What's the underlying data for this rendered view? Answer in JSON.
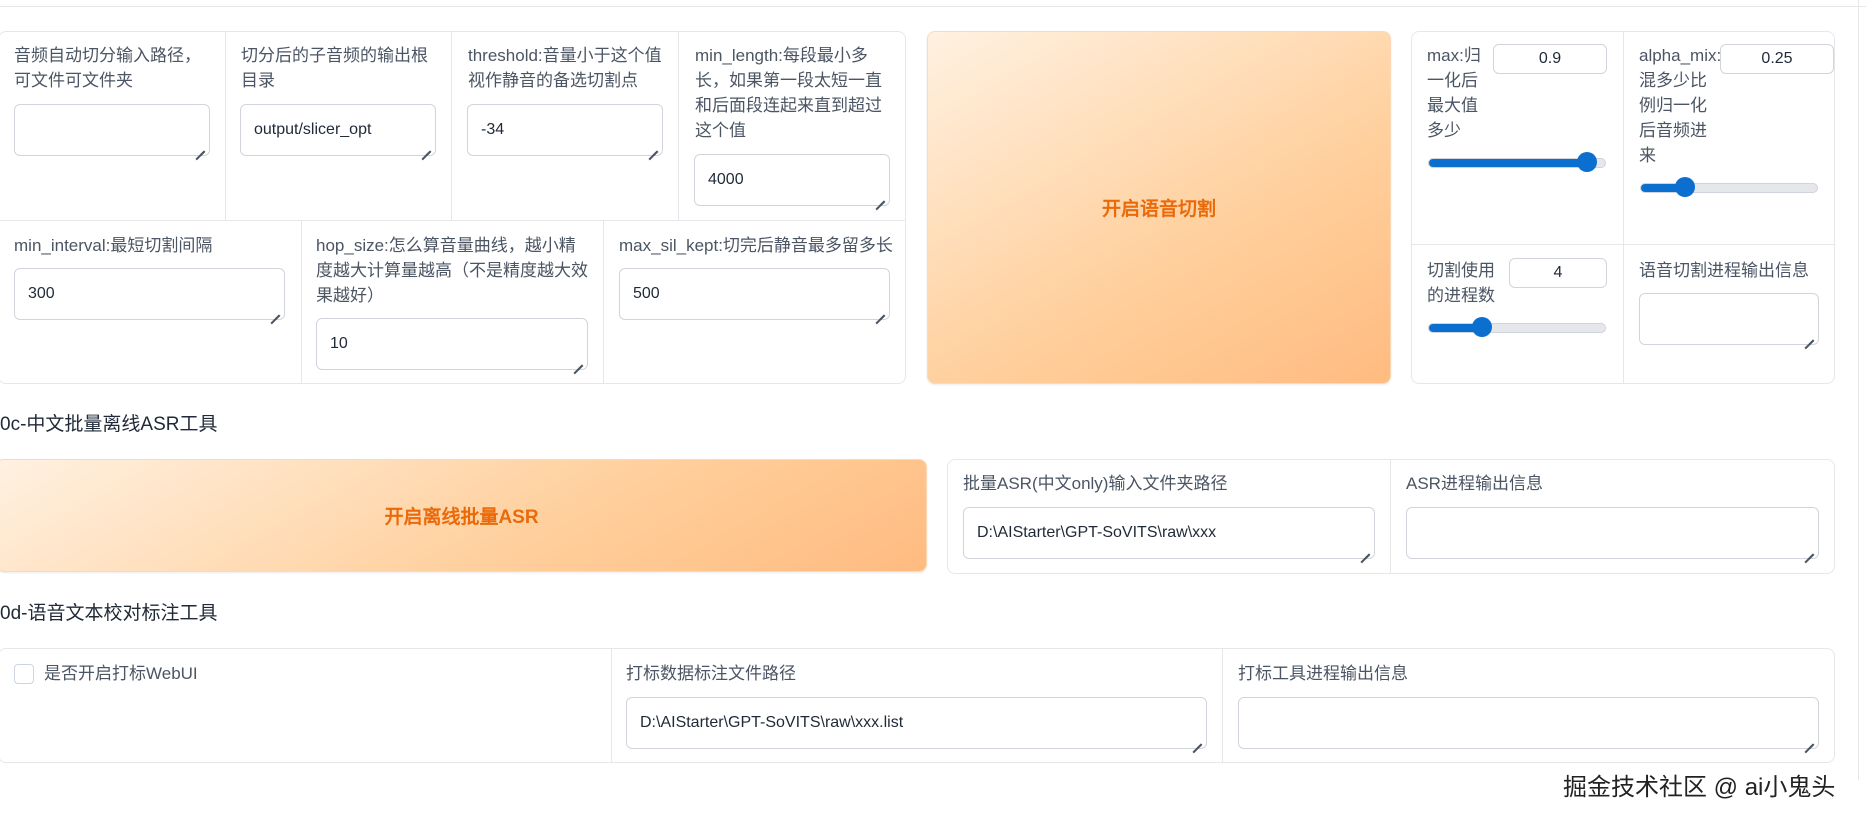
{
  "slicer": {
    "input_path": {
      "label": "音频自动切分输入路径，可文件可文件夹",
      "value": ""
    },
    "output_dir": {
      "label": "切分后的子音频的输出根目录",
      "value": "output/slicer_opt"
    },
    "threshold": {
      "label": "threshold:音量小于这个值视作静音的备选切割点",
      "value": "-34"
    },
    "min_length": {
      "label": "min_length:每段最小多长，如果第一段太短一直和后面段连起来直到超过这个值",
      "value": "4000"
    },
    "min_interval": {
      "label": "min_interval:最短切割间隔",
      "value": "300"
    },
    "hop_size": {
      "label": "hop_size:怎么算音量曲线，越小精度越大计算量越高（不是精度越大效果越好）",
      "value": "10"
    },
    "max_sil_kept": {
      "label": "max_sil_kept:切完后静音最多留多长",
      "value": "500"
    },
    "start_button": "开启语音切割",
    "max": {
      "label": "max:归一化后最大值多少",
      "value": "0.9",
      "level": 0.9
    },
    "alpha_mix": {
      "label": "alpha_mix:混多少比例归一化后音频进来",
      "value": "0.25",
      "level": 0.25
    },
    "n_process": {
      "label": "切割使用的进程数",
      "value": "4",
      "level": 0.3
    },
    "output_info": {
      "label": "语音切割进程输出信息",
      "value": ""
    }
  },
  "asr": {
    "section_title": "0c-中文批量离线ASR工具",
    "start_button": "开启离线批量ASR",
    "input_dir": {
      "label": "批量ASR(中文only)输入文件夹路径",
      "value": "D:\\AIStarter\\GPT-SoVITS\\raw\\xxx"
    },
    "output_info": {
      "label": "ASR进程输出信息",
      "value": ""
    }
  },
  "label": {
    "section_title": "0d-语音文本校对标注工具",
    "webui_checkbox": {
      "label": "是否开启打标WebUI",
      "checked": false
    },
    "list_path": {
      "label": "打标数据标注文件路径",
      "value": "D:\\AIStarter\\GPT-SoVITS\\raw\\xxx.list"
    },
    "output_info": {
      "label": "打标工具进程输出信息",
      "value": ""
    }
  },
  "watermark": "掘金技术社区 @ ai小鬼头",
  "colors": {
    "accent": "#0b6fd0",
    "button_text": "#ea6a0a",
    "button_bg": "#ffcf9c"
  }
}
